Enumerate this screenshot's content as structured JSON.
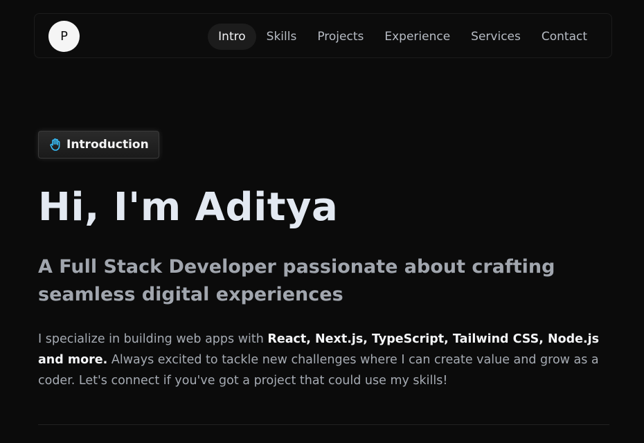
{
  "navbar": {
    "logo_letter": "P",
    "links": [
      {
        "label": "Intro",
        "active": true
      },
      {
        "label": "Skills",
        "active": false
      },
      {
        "label": "Projects",
        "active": false
      },
      {
        "label": "Experience",
        "active": false
      },
      {
        "label": "Services",
        "active": false
      },
      {
        "label": "Contact",
        "active": false
      }
    ]
  },
  "badge": {
    "icon": "waving-hand-icon",
    "label": "Introduction",
    "icon_color": "#38bdf8"
  },
  "hero": {
    "title": "Hi, I'm Aditya",
    "subtitle": "A Full Stack Developer passionate about crafting seamless digital experiences",
    "body_prefix": "I specialize in building web apps with ",
    "body_highlight": "React, Next.js, TypeScript, Tailwind CSS, Node.js and more.",
    "body_suffix": " Always excited to tackle new challenges where I can create value and grow as a coder. Let's connect if you've got a project that could use my skills!"
  },
  "colors": {
    "background": "#0b0b0b",
    "title": "#e3e9f2",
    "muted": "#a1a6ae",
    "accent": "#38bdf8"
  }
}
